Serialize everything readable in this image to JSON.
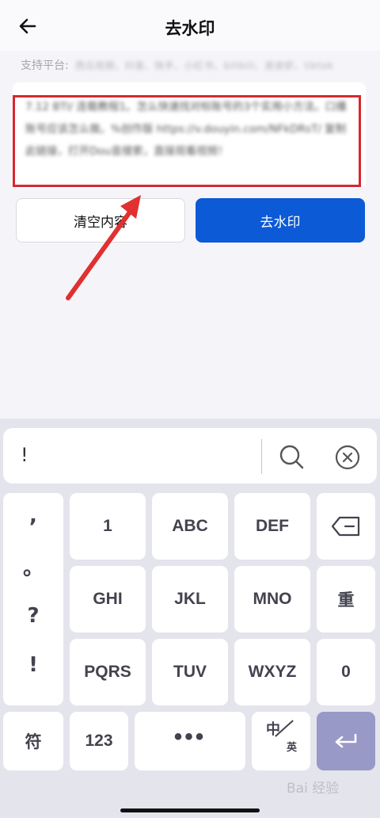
{
  "header": {
    "title": "去水印"
  },
  "platforms": {
    "label": "支持平台:",
    "list": "西瓜视频、抖音、快手、小红书、bilibili、皮皮虾、tiktok"
  },
  "textbox": {
    "content": "7.12 BTl/ 连载教程1。怎么快速找对标账号的3个实用小方法。口播账号应该怎么做。%创作版 https://v.douyin.com/NFkDRsT/ 复制此链接，打开Dou音搜索，直接观看视频！"
  },
  "buttons": {
    "clear": "清空内容",
    "remove": "去水印"
  },
  "keyboard": {
    "input_text": "!",
    "punctuation": [
      ",",
      "。",
      "?",
      "!"
    ],
    "keys": [
      "1",
      "ABC",
      "DEF",
      "GHI",
      "JKL",
      "MNO",
      "重",
      "PQRS",
      "TUV",
      "WXYZ",
      "0"
    ],
    "symbol": "符",
    "num": "123",
    "lang_zh": "中",
    "lang_en": "英"
  },
  "watermark": "Bai 经验",
  "colors": {
    "primary": "#0c5ad6",
    "highlight": "#d7282f",
    "enter": "#9999c7"
  }
}
